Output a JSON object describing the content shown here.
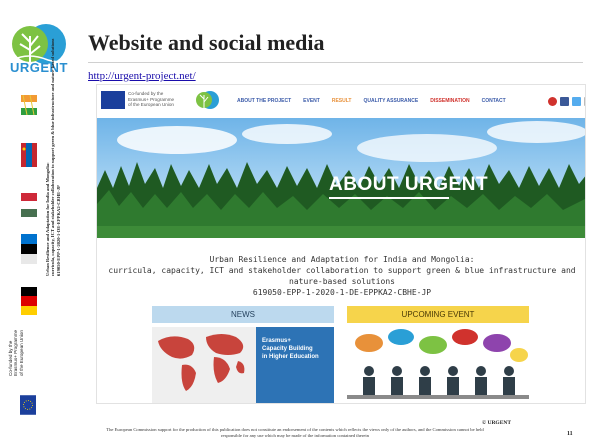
{
  "sidebar": {
    "logo_text": "URGENT",
    "vertical_title": "Urban Resilience and Adaptation for India and Mongolia:",
    "vertical_subtitle": "curricula, capacity, ICT and stakeholder collaboration to support green & blue infrastructure and nature-based solutions",
    "vertical_code": "619050-EPP-1-2020-1-DE-EPPKA2-CBHE-JP",
    "cofund_line1": "Co-funded by the",
    "cofund_line2": "Erasmus+ Programme",
    "cofund_line3": "of the European Union"
  },
  "slide": {
    "title": "Website and social media",
    "url": "http://urgent-project.net/",
    "copyright": "© URGENT",
    "disclaimer": "The European Commission support for the production of this publication does not constitute an endorsement of the contents which reflects the views only of the authors, and the Commission cannot be held responsible for any use which may be made of the information contained therein",
    "page_number": "11"
  },
  "website": {
    "eu_line1": "Co-funded by the",
    "eu_line2": "Erasmus+ Programme",
    "eu_line3": "of the European Union",
    "nav": [
      "ABOUT THE PROJECT",
      "EVENT",
      "RESULT",
      "QUALITY ASSURANCE",
      "DISSEMINATION",
      "CONTACT"
    ],
    "hero_title": "ABOUT URGENT",
    "more_button": "MORE",
    "project_line1": "Urban Resilience and Adaptation for India and Mongolia:",
    "project_line2": "curricula, capacity, ICT and stakeholder collaboration to support green & blue infrastructure and",
    "project_line3": "nature-based solutions",
    "project_code": "619050-EPP-1-2020-1-DE-EPPKA2-CBHE-JP",
    "news_header": "NEWS",
    "event_header": "UPCOMING EVENT",
    "news_image_line1": "Erasmus+",
    "news_image_line2": "Capacity Building",
    "news_image_line3": "in Higher Education"
  },
  "colors": {
    "eu_blue": "#1b3f9c",
    "nav_blue": "#3b5ba9",
    "nav_orange": "#e8913a",
    "nav_red": "#d0322d",
    "more_green": "#2e9e3f",
    "news_blue": "#bcd9ee",
    "event_yellow": "#f6d44b"
  }
}
